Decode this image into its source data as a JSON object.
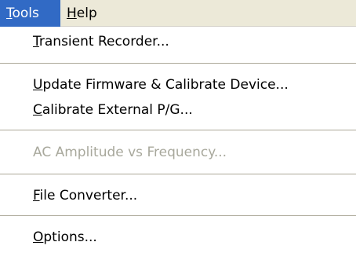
{
  "menubar": {
    "tools_label_u": "T",
    "tools_label_rest": "ools",
    "help_label_u": "H",
    "help_label_rest": "elp"
  },
  "menu": {
    "transient_recorder_u": "T",
    "transient_recorder_rest": "ransient Recorder...",
    "update_firmware_u": "U",
    "update_firmware_rest": "pdate Firmware & Calibrate Device...",
    "calibrate_external_u": "C",
    "calibrate_external_rest": "alibrate External P/G...",
    "ac_amplitude": "AC Amplitude vs Frequency...",
    "file_converter_u": "F",
    "file_converter_rest": "ile Converter...",
    "options_u": "O",
    "options_rest": "ptions..."
  },
  "colors": {
    "menubar_bg": "#ece9d8",
    "highlight": "#316ac5",
    "disabled_text": "#a8a89c",
    "separator": "#aca899"
  }
}
